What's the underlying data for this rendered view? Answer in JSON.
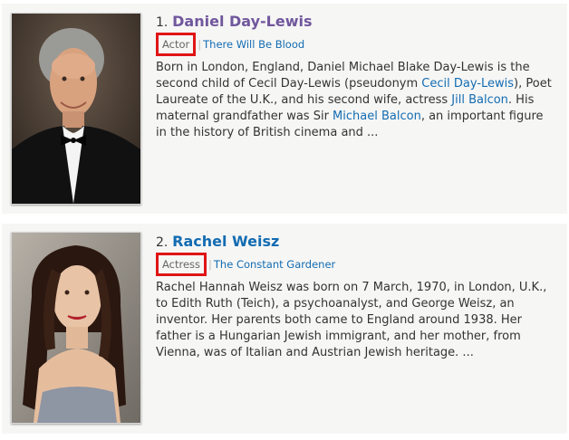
{
  "results": [
    {
      "index": "1.",
      "name": "Daniel Day-Lewis",
      "name_visited": true,
      "role": "Actor",
      "separator": "|",
      "known_for": "There Will Be Blood",
      "bio_parts": {
        "p1": "Born in London, England, Daniel Michael Blake Day-Lewis is the second child of Cecil Day-Lewis (pseudonym ",
        "link1": "Cecil Day-Lewis",
        "p2": "), Poet Laureate of the U.K., and his second wife, actress ",
        "link2": "Jill Balcon",
        "p3": ". His maternal grandfather was Sir ",
        "link3": "Michael Balcon",
        "p4": ", an important figure in the history of British cinema and ..."
      },
      "photo_icon": "portrait-man-tuxedo"
    },
    {
      "index": "2.",
      "name": "Rachel Weisz",
      "name_visited": false,
      "role": "Actress",
      "separator": "|",
      "known_for": "The Constant Gardener",
      "bio": "Rachel Hannah Weisz was born on 7 March, 1970, in London, U.K., to Edith Ruth (Teich), a psychoanalyst, and George Weisz, an inventor. Her parents both came to England around 1938. Her father is a Hungarian Jewish immigrant, and her mother, from Vienna, was of Italian and Austrian Jewish heritage. ...",
      "photo_icon": "portrait-woman-dress"
    }
  ],
  "colors": {
    "visited_link": "#70579d",
    "link": "#136cb2",
    "highlight_box": "#e01515",
    "item_bg": "#f6f6f5"
  }
}
